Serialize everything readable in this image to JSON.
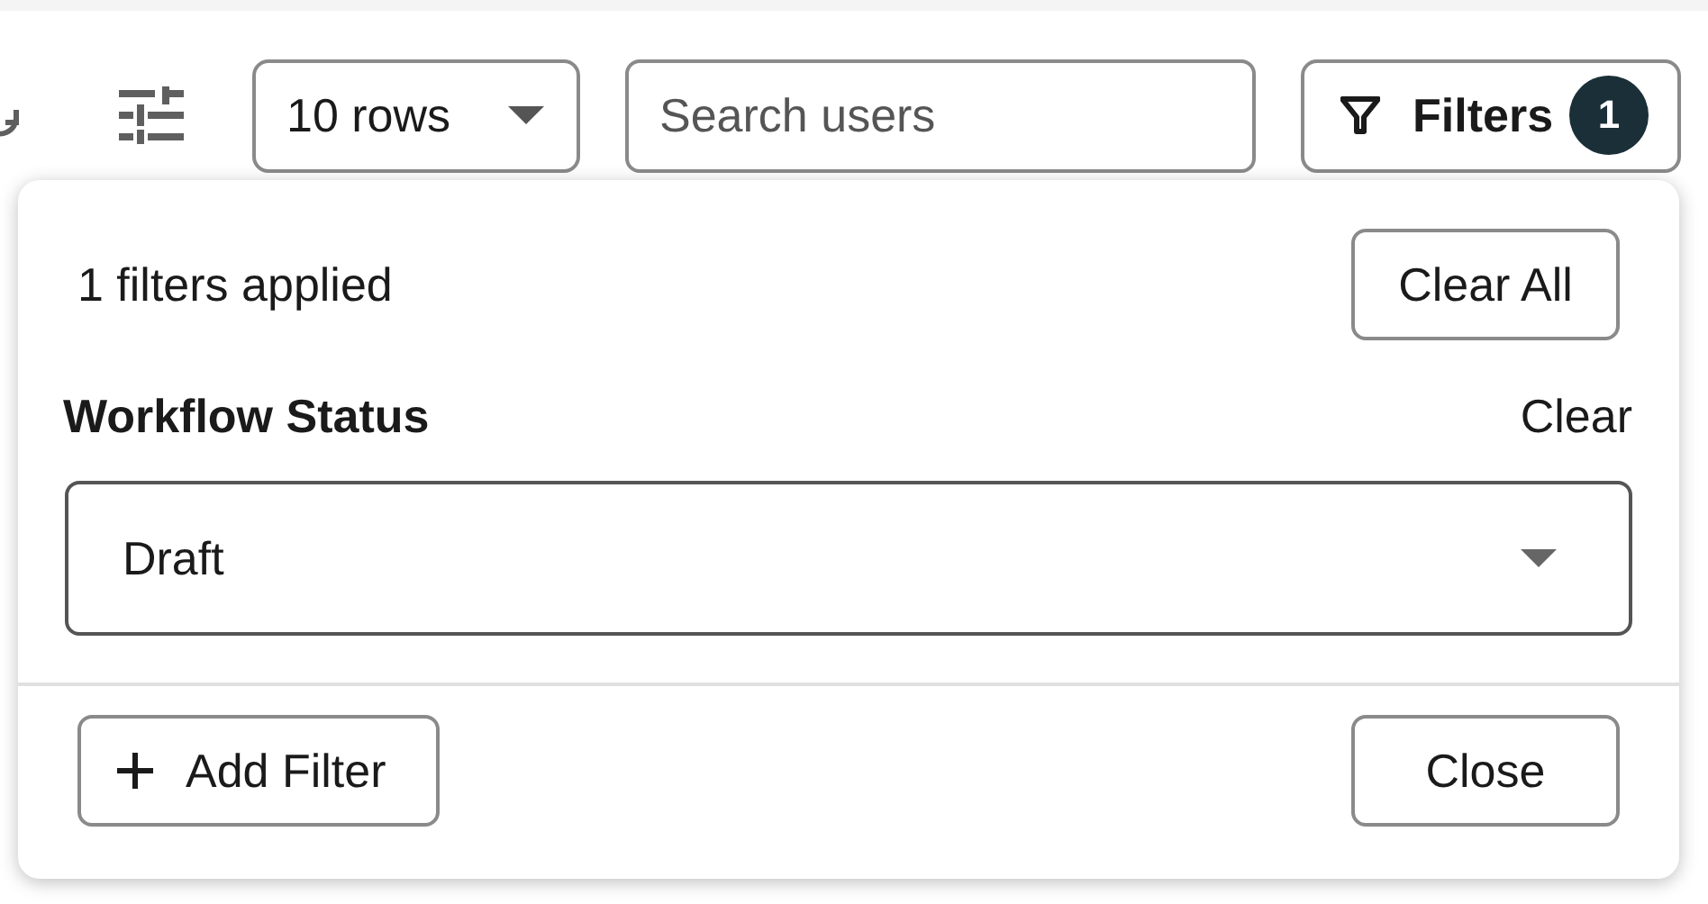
{
  "toolbar": {
    "rows_select": {
      "value": "10 rows"
    },
    "search": {
      "placeholder": "Search users"
    },
    "filters_button": {
      "label": "Filters",
      "count": "1"
    }
  },
  "filter_panel": {
    "summary": "1 filters applied",
    "clear_all": "Clear All",
    "filters": [
      {
        "label": "Workflow Status",
        "clear": "Clear",
        "value": "Draft"
      }
    ],
    "add_filter": "Add Filter",
    "close": "Close"
  }
}
